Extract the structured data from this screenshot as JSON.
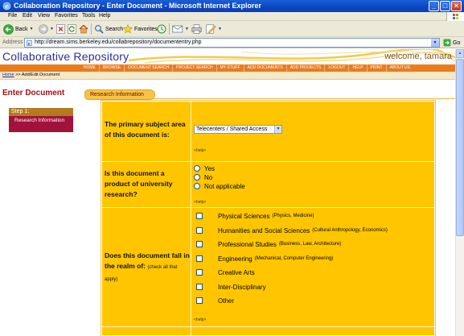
{
  "browser": {
    "window_title": "Collaboration Repository - Enter Document - Microsoft Internet Explorer",
    "menu": [
      "File",
      "Edit",
      "View",
      "Favorites",
      "Tools",
      "Help"
    ],
    "toolbar": {
      "back": "Back",
      "search": "Search",
      "favorites": "Favorites"
    },
    "address_label": "Address",
    "url": "http://dream.sims.berkeley.edu/collabrepository/documententry.php",
    "go_label": "Go"
  },
  "site": {
    "title": "Collaborative Repository",
    "welcome": "welcome, tamara",
    "nav": [
      "HOME",
      "BROWSE",
      "DOCUMENT SEARCH",
      "PROJECT SEARCH",
      "MY STUFF",
      "ADD DOCUMENTS",
      "ADD PROJECTS",
      "LOGOUT",
      "HELP",
      "PRINT",
      "ABOUT US"
    ],
    "breadcrumb": {
      "home": "Home",
      "rest": " >> Add/Edit Document"
    }
  },
  "page": {
    "heading": "Enter Document",
    "section_tab": "Research Information",
    "step": {
      "title": "Step 1:",
      "item": "Research Information"
    }
  },
  "form": {
    "q1": {
      "label": "The primary subject area of this document is:",
      "selected": "Telecenters / Shared Access",
      "help": "<help>"
    },
    "q2": {
      "label": "Is this document a product of university research?",
      "options": [
        "Yes",
        "No",
        "Not applicable"
      ],
      "help": "<help>"
    },
    "q3": {
      "label": "Does this document fall in the realm of:",
      "label_note": "(check all that apply)",
      "options": [
        {
          "label": "Physical Sciences",
          "note": "(Physics, Medicine)"
        },
        {
          "label": "Humanities and Social Sciences",
          "note": "(Cultural Anthropology, Economics)"
        },
        {
          "label": "Professional Studies",
          "note": "(Business, Law, Architecture)"
        },
        {
          "label": "Engineering",
          "note": "(Mechanical, Computer Engineering)"
        },
        {
          "label": "Creative Arts",
          "note": ""
        },
        {
          "label": "Inter-Disciplinary",
          "note": ""
        },
        {
          "label": "Other",
          "note": ""
        }
      ],
      "help": "<help>"
    }
  }
}
